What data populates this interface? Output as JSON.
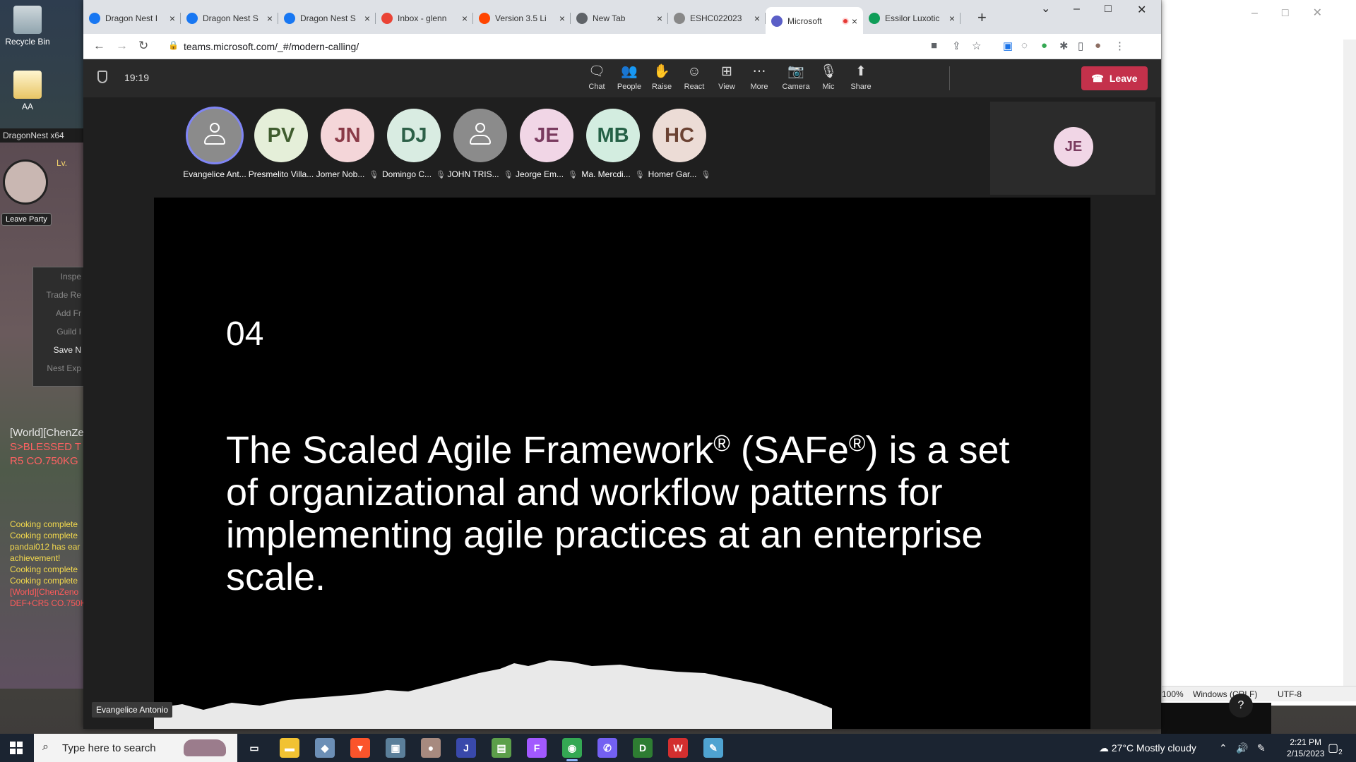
{
  "desktop": {
    "icons": [
      {
        "label": "Recycle Bin"
      },
      {
        "label": "AA"
      }
    ]
  },
  "game": {
    "window_title": "DragonNest x64",
    "level_prefix": "Lv.",
    "leave_party": "Leave Party",
    "context_menu": [
      "Inspe",
      "Trade Re",
      "Add Fr",
      "Guild I",
      "Save N",
      "Nest Exp"
    ],
    "world_chat": [
      "[World][ChenZe",
      "S>BLESSED T",
      "R5 CO.750KG"
    ],
    "chat_log": [
      "Cooking complete",
      "Cooking complete",
      "pandai012 has ear",
      "achievement!",
      "Cooking complete",
      "Cooking complete",
      "[World][ChenZeno",
      "DEF+CR5 CO.750K"
    ]
  },
  "browser": {
    "tabs": [
      {
        "title": "Dragon Nest I",
        "icon": "facebook-icon",
        "color": "#1877f2"
      },
      {
        "title": "Dragon Nest S",
        "icon": "facebook-icon",
        "color": "#1877f2"
      },
      {
        "title": "Dragon Nest S",
        "icon": "facebook-icon",
        "color": "#1877f2"
      },
      {
        "title": "Inbox - glenn",
        "icon": "gmail-icon",
        "color": "#ea4335"
      },
      {
        "title": "Version 3.5 Li",
        "icon": "reddit-icon",
        "color": "#ff4500"
      },
      {
        "title": "New Tab",
        "icon": "chrome-icon",
        "color": "#5f6368"
      },
      {
        "title": "ESHC022023",
        "icon": "document-icon",
        "color": "#888888"
      },
      {
        "title": "Microsoft",
        "icon": "teams-icon",
        "color": "#5b5fc7",
        "active": true,
        "recording": true
      },
      {
        "title": "Essilor Luxotic",
        "icon": "sheets-icon",
        "color": "#0f9d58"
      }
    ],
    "url": "teams.microsoft.com/_#/modern-calling/"
  },
  "meeting": {
    "timer": "19:19",
    "controls": [
      {
        "label": "Chat",
        "icon": "chat-icon",
        "glyph": "🗨"
      },
      {
        "label": "People",
        "icon": "people-icon",
        "glyph": "👥"
      },
      {
        "label": "Raise",
        "icon": "hand-icon",
        "glyph": "✋"
      },
      {
        "label": "React",
        "icon": "smile-icon",
        "glyph": "☺"
      },
      {
        "label": "View",
        "icon": "grid-icon",
        "glyph": "⊞"
      },
      {
        "label": "More",
        "icon": "more-icon",
        "glyph": "⋯"
      },
      {
        "label": "Camera",
        "icon": "camera-off-icon",
        "glyph": "📷"
      },
      {
        "label": "Mic",
        "icon": "mic-off-icon",
        "glyph": "🎙"
      },
      {
        "label": "Share",
        "icon": "share-icon",
        "glyph": "⬆"
      }
    ],
    "leave_label": "Leave",
    "participants": [
      {
        "initials": "",
        "name": "Evangelice Ant...",
        "bg": "#8b8b8b",
        "fg": "#ffffff",
        "muted": false,
        "speaking": true
      },
      {
        "initials": "PV",
        "name": "Presmelito Villa...",
        "bg": "#e5efd9",
        "fg": "#3f5c2e",
        "muted": false
      },
      {
        "initials": "JN",
        "name": "Jomer Nob...",
        "bg": "#f4d6d9",
        "fg": "#8a3a47",
        "muted": true
      },
      {
        "initials": "DJ",
        "name": "Domingo C...",
        "bg": "#d9ece2",
        "fg": "#2d6048",
        "muted": true
      },
      {
        "initials": "",
        "name": "JOHN TRIS...",
        "bg": "#8b8b8b",
        "fg": "#ffffff",
        "muted": true
      },
      {
        "initials": "JE",
        "name": "Jeorge Em...",
        "bg": "#f1d6e6",
        "fg": "#7a3b5f",
        "muted": true
      },
      {
        "initials": "MB",
        "name": "Ma. Mercdi...",
        "bg": "#d3ede0",
        "fg": "#256146",
        "muted": true
      },
      {
        "initials": "HC",
        "name": "Homer Gar...",
        "bg": "#ecdcd6",
        "fg": "#6b4233",
        "muted": true
      }
    ],
    "self_initials": "JE",
    "slide": {
      "number": "04",
      "text_parts": [
        "The Scaled Agile Framework",
        "®",
        " (SAFe",
        "®",
        ") is a set of organizational and workflow patterns for implementing agile practices at an enterprise scale."
      ]
    },
    "speaker": "Evangelice Antonio"
  },
  "notepad": {
    "zoom": "100%",
    "line_ending": "Windows (CRLF)",
    "encoding": "UTF-8"
  },
  "taskbar": {
    "search_placeholder": "Type here to search",
    "weather": "27°C  Mostly cloudy",
    "time": "2:21 PM",
    "date": "2/15/2023",
    "notifications": "2"
  }
}
